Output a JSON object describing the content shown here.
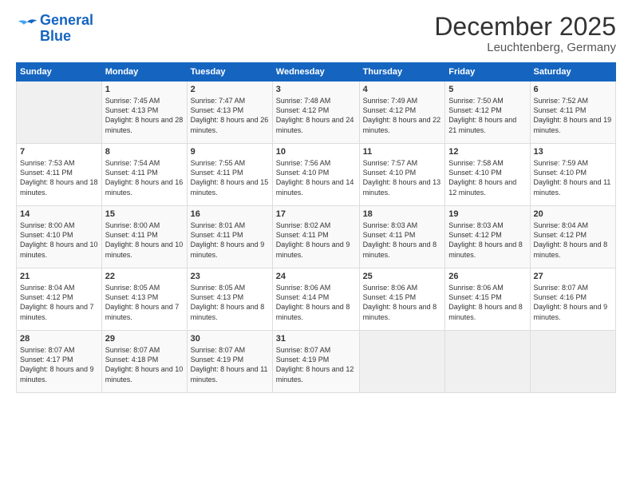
{
  "logo": {
    "line1": "General",
    "line2": "Blue"
  },
  "title": "December 2025",
  "location": "Leuchtenberg, Germany",
  "headers": [
    "Sunday",
    "Monday",
    "Tuesday",
    "Wednesday",
    "Thursday",
    "Friday",
    "Saturday"
  ],
  "weeks": [
    [
      {
        "day": "",
        "sunrise": "",
        "sunset": "",
        "daylight": ""
      },
      {
        "day": "1",
        "sunrise": "Sunrise: 7:45 AM",
        "sunset": "Sunset: 4:13 PM",
        "daylight": "Daylight: 8 hours and 28 minutes."
      },
      {
        "day": "2",
        "sunrise": "Sunrise: 7:47 AM",
        "sunset": "Sunset: 4:13 PM",
        "daylight": "Daylight: 8 hours and 26 minutes."
      },
      {
        "day": "3",
        "sunrise": "Sunrise: 7:48 AM",
        "sunset": "Sunset: 4:12 PM",
        "daylight": "Daylight: 8 hours and 24 minutes."
      },
      {
        "day": "4",
        "sunrise": "Sunrise: 7:49 AM",
        "sunset": "Sunset: 4:12 PM",
        "daylight": "Daylight: 8 hours and 22 minutes."
      },
      {
        "day": "5",
        "sunrise": "Sunrise: 7:50 AM",
        "sunset": "Sunset: 4:12 PM",
        "daylight": "Daylight: 8 hours and 21 minutes."
      },
      {
        "day": "6",
        "sunrise": "Sunrise: 7:52 AM",
        "sunset": "Sunset: 4:11 PM",
        "daylight": "Daylight: 8 hours and 19 minutes."
      }
    ],
    [
      {
        "day": "7",
        "sunrise": "Sunrise: 7:53 AM",
        "sunset": "Sunset: 4:11 PM",
        "daylight": "Daylight: 8 hours and 18 minutes."
      },
      {
        "day": "8",
        "sunrise": "Sunrise: 7:54 AM",
        "sunset": "Sunset: 4:11 PM",
        "daylight": "Daylight: 8 hours and 16 minutes."
      },
      {
        "day": "9",
        "sunrise": "Sunrise: 7:55 AM",
        "sunset": "Sunset: 4:11 PM",
        "daylight": "Daylight: 8 hours and 15 minutes."
      },
      {
        "day": "10",
        "sunrise": "Sunrise: 7:56 AM",
        "sunset": "Sunset: 4:10 PM",
        "daylight": "Daylight: 8 hours and 14 minutes."
      },
      {
        "day": "11",
        "sunrise": "Sunrise: 7:57 AM",
        "sunset": "Sunset: 4:10 PM",
        "daylight": "Daylight: 8 hours and 13 minutes."
      },
      {
        "day": "12",
        "sunrise": "Sunrise: 7:58 AM",
        "sunset": "Sunset: 4:10 PM",
        "daylight": "Daylight: 8 hours and 12 minutes."
      },
      {
        "day": "13",
        "sunrise": "Sunrise: 7:59 AM",
        "sunset": "Sunset: 4:10 PM",
        "daylight": "Daylight: 8 hours and 11 minutes."
      }
    ],
    [
      {
        "day": "14",
        "sunrise": "Sunrise: 8:00 AM",
        "sunset": "Sunset: 4:10 PM",
        "daylight": "Daylight: 8 hours and 10 minutes."
      },
      {
        "day": "15",
        "sunrise": "Sunrise: 8:00 AM",
        "sunset": "Sunset: 4:11 PM",
        "daylight": "Daylight: 8 hours and 10 minutes."
      },
      {
        "day": "16",
        "sunrise": "Sunrise: 8:01 AM",
        "sunset": "Sunset: 4:11 PM",
        "daylight": "Daylight: 8 hours and 9 minutes."
      },
      {
        "day": "17",
        "sunrise": "Sunrise: 8:02 AM",
        "sunset": "Sunset: 4:11 PM",
        "daylight": "Daylight: 8 hours and 9 minutes."
      },
      {
        "day": "18",
        "sunrise": "Sunrise: 8:03 AM",
        "sunset": "Sunset: 4:11 PM",
        "daylight": "Daylight: 8 hours and 8 minutes."
      },
      {
        "day": "19",
        "sunrise": "Sunrise: 8:03 AM",
        "sunset": "Sunset: 4:12 PM",
        "daylight": "Daylight: 8 hours and 8 minutes."
      },
      {
        "day": "20",
        "sunrise": "Sunrise: 8:04 AM",
        "sunset": "Sunset: 4:12 PM",
        "daylight": "Daylight: 8 hours and 8 minutes."
      }
    ],
    [
      {
        "day": "21",
        "sunrise": "Sunrise: 8:04 AM",
        "sunset": "Sunset: 4:12 PM",
        "daylight": "Daylight: 8 hours and 7 minutes."
      },
      {
        "day": "22",
        "sunrise": "Sunrise: 8:05 AM",
        "sunset": "Sunset: 4:13 PM",
        "daylight": "Daylight: 8 hours and 7 minutes."
      },
      {
        "day": "23",
        "sunrise": "Sunrise: 8:05 AM",
        "sunset": "Sunset: 4:13 PM",
        "daylight": "Daylight: 8 hours and 8 minutes."
      },
      {
        "day": "24",
        "sunrise": "Sunrise: 8:06 AM",
        "sunset": "Sunset: 4:14 PM",
        "daylight": "Daylight: 8 hours and 8 minutes."
      },
      {
        "day": "25",
        "sunrise": "Sunrise: 8:06 AM",
        "sunset": "Sunset: 4:15 PM",
        "daylight": "Daylight: 8 hours and 8 minutes."
      },
      {
        "day": "26",
        "sunrise": "Sunrise: 8:06 AM",
        "sunset": "Sunset: 4:15 PM",
        "daylight": "Daylight: 8 hours and 8 minutes."
      },
      {
        "day": "27",
        "sunrise": "Sunrise: 8:07 AM",
        "sunset": "Sunset: 4:16 PM",
        "daylight": "Daylight: 8 hours and 9 minutes."
      }
    ],
    [
      {
        "day": "28",
        "sunrise": "Sunrise: 8:07 AM",
        "sunset": "Sunset: 4:17 PM",
        "daylight": "Daylight: 8 hours and 9 minutes."
      },
      {
        "day": "29",
        "sunrise": "Sunrise: 8:07 AM",
        "sunset": "Sunset: 4:18 PM",
        "daylight": "Daylight: 8 hours and 10 minutes."
      },
      {
        "day": "30",
        "sunrise": "Sunrise: 8:07 AM",
        "sunset": "Sunset: 4:19 PM",
        "daylight": "Daylight: 8 hours and 11 minutes."
      },
      {
        "day": "31",
        "sunrise": "Sunrise: 8:07 AM",
        "sunset": "Sunset: 4:19 PM",
        "daylight": "Daylight: 8 hours and 12 minutes."
      },
      {
        "day": "",
        "sunrise": "",
        "sunset": "",
        "daylight": ""
      },
      {
        "day": "",
        "sunrise": "",
        "sunset": "",
        "daylight": ""
      },
      {
        "day": "",
        "sunrise": "",
        "sunset": "",
        "daylight": ""
      }
    ]
  ]
}
